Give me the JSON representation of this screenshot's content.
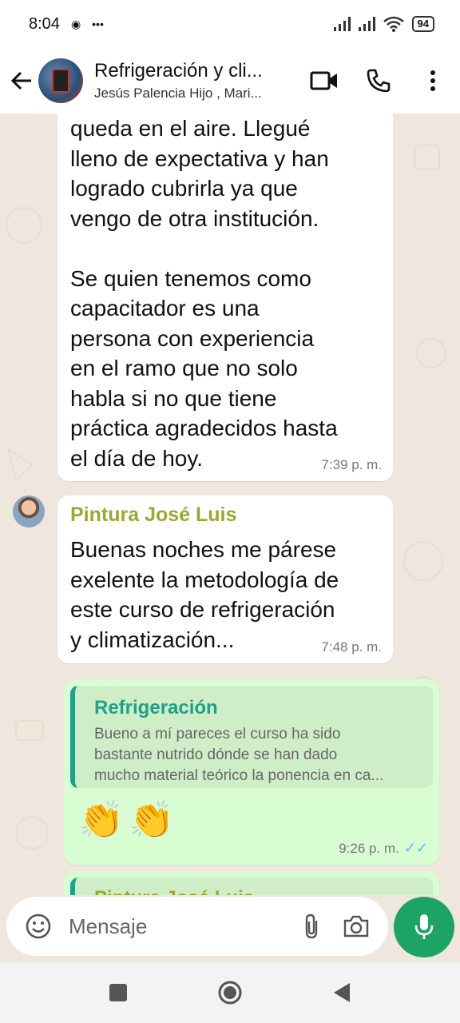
{
  "status_bar": {
    "time": "8:04",
    "dots": "•••",
    "battery": "94"
  },
  "header": {
    "title": "Refrigeración y cli...",
    "subtitle": "Jesús Palencia Hijo , Mari..."
  },
  "messages": [
    {
      "text": "queda en el aire. Llegué\nlleno de expectativa y han\nlogrado cubrirla ya que\nvengo de otra institución.\n\nSe quien tenemos como\ncapacitador es una\npersona con experiencia\nen el ramo que no solo\nhabla si no que tiene\npráctica agradecidos hasta\nel día de hoy.",
      "time": "7:39 p. m."
    },
    {
      "sender": "Pintura José Luis",
      "text": "Buenas noches me párese\nexelente la metodología de\neste curso de refrigeración\ny climatización...",
      "time": "7:48 p. m."
    },
    {
      "quote_name": "Refrigeración",
      "quote_lines": [
        "Bueno a mí pareces el curso ha sido",
        "bastante nutrido dónde se han dado",
        "mucho material teórico la ponencia en ca..."
      ],
      "emoji": "👏👏",
      "time": "9:26 p. m."
    },
    {
      "sender": "Pintura José Luis"
    }
  ],
  "input": {
    "placeholder": "Mensaje"
  }
}
